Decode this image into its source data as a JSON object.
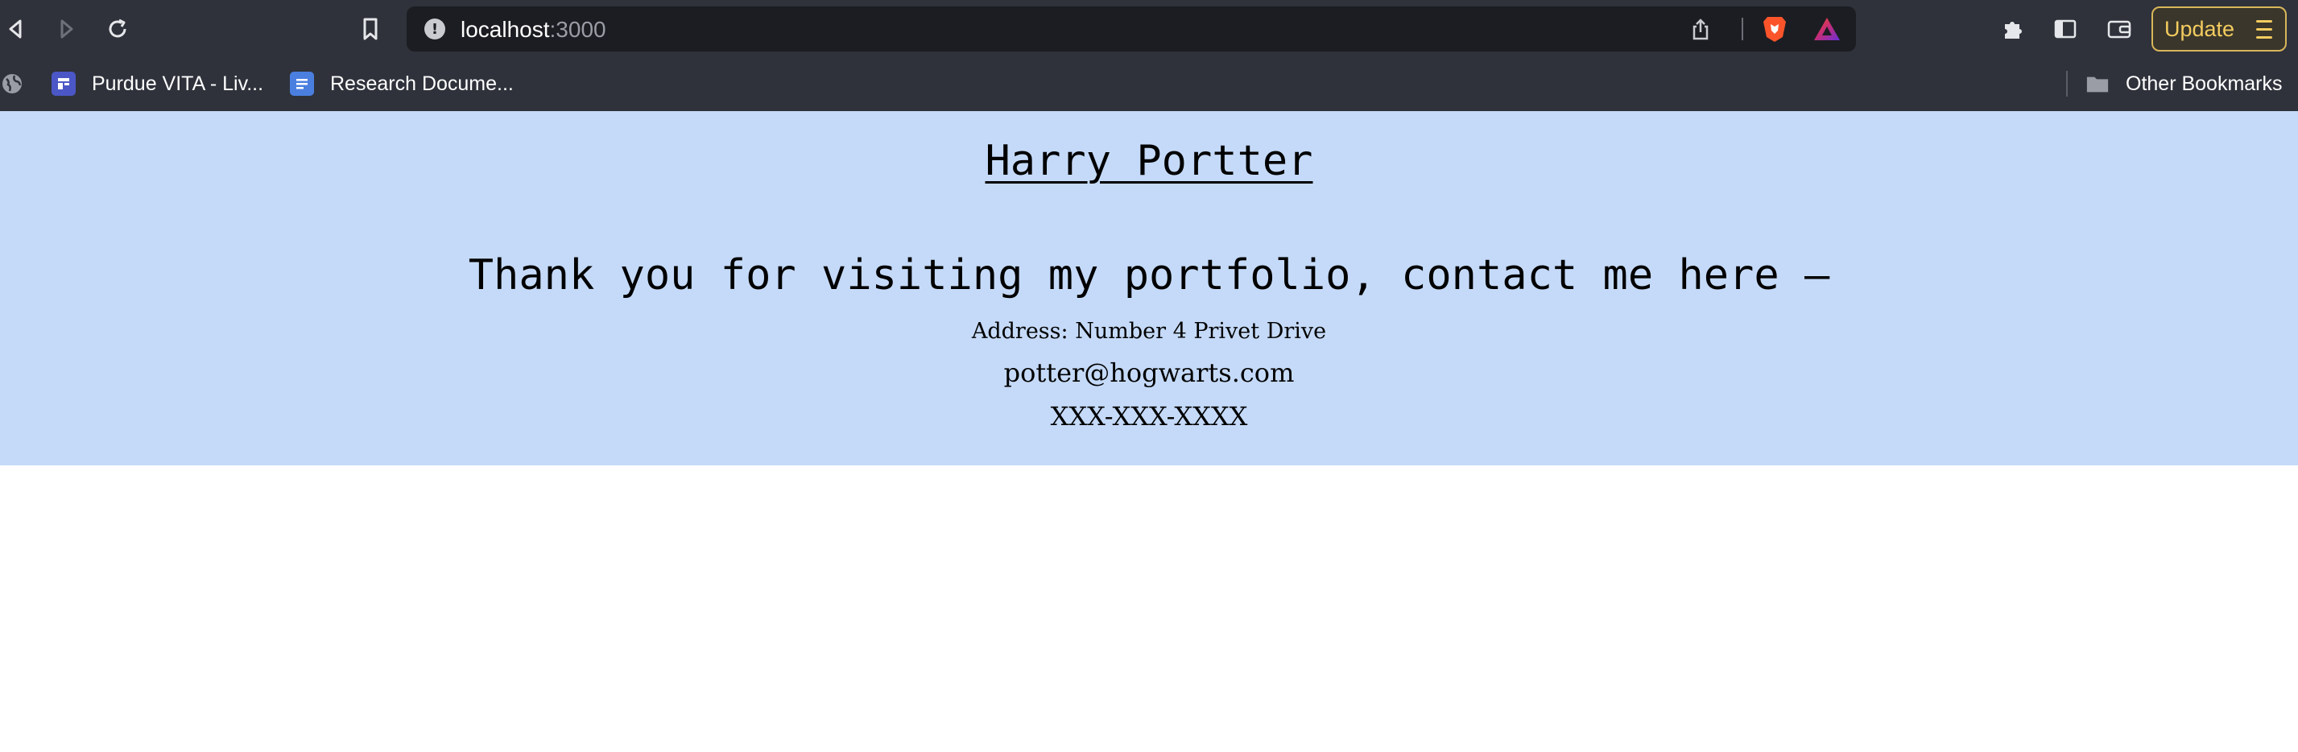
{
  "browser": {
    "url_host": "localhost",
    "url_port": ":3000",
    "update_label": "Update",
    "accent": "#f3cc5f",
    "chrome_bg": "#2f323b",
    "icons": [
      "back-icon",
      "forward-icon",
      "reload-icon",
      "bookmark-icon",
      "site-info-icon",
      "share-icon",
      "brave-shields-icon",
      "brave-rewards-icon",
      "extensions-icon",
      "sidebar-icon",
      "wallet-icon",
      "menu-icon"
    ]
  },
  "bookmarks": {
    "items": [
      {
        "label": "Purdue VITA - Liv..."
      },
      {
        "label": "Research Docume..."
      }
    ],
    "other_label": "Other Bookmarks"
  },
  "page": {
    "background": "#c5daf8",
    "name": "Harry Portter",
    "message": "Thank you for visiting my portfolio, contact me here —",
    "address": "Address: Number 4 Privet Drive",
    "email": "potter@hogwarts.com",
    "phone": "XXX-XXX-XXXX"
  }
}
